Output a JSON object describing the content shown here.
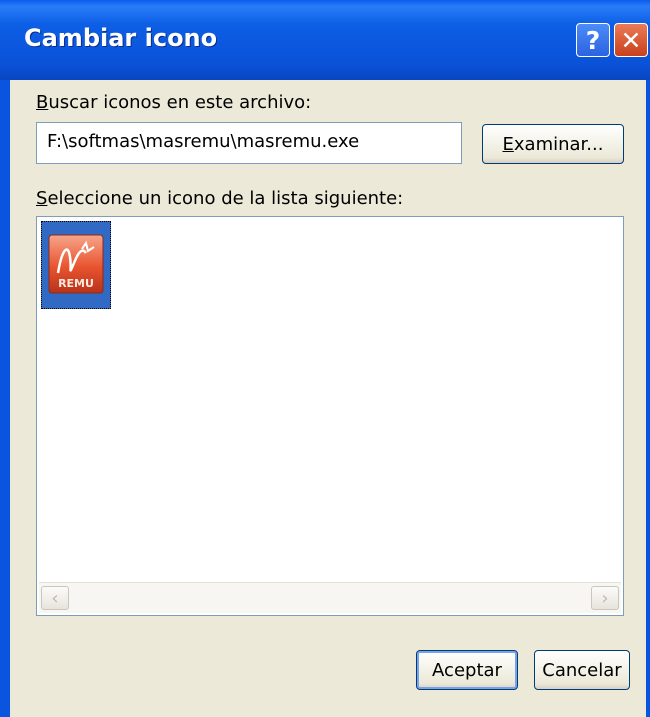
{
  "window": {
    "title": "Cambiar icono",
    "help_glyph": "?",
    "close_glyph": "✕"
  },
  "file_label": {
    "accel": "B",
    "rest": "uscar iconos en este archivo:"
  },
  "file_path": "F:\\softmas\\masremu\\masremu.exe",
  "browse_button": {
    "accel": "E",
    "rest": "xaminar..."
  },
  "list_label": {
    "accel": "S",
    "rest": "eleccione un icono de la lista siguiente:"
  },
  "icons": [
    {
      "name": "masremu-app-icon",
      "text": "REMU",
      "selected": true
    }
  ],
  "scrollbar": {
    "left_glyph": "‹",
    "right_glyph": "›"
  },
  "ok_button": "Aceptar",
  "cancel_button": "Cancelar",
  "colors": {
    "titlebar": "#0a55e0",
    "dialog_bg": "#ece9d8",
    "selection": "#316ac5",
    "icon_red": "#e8542f"
  }
}
